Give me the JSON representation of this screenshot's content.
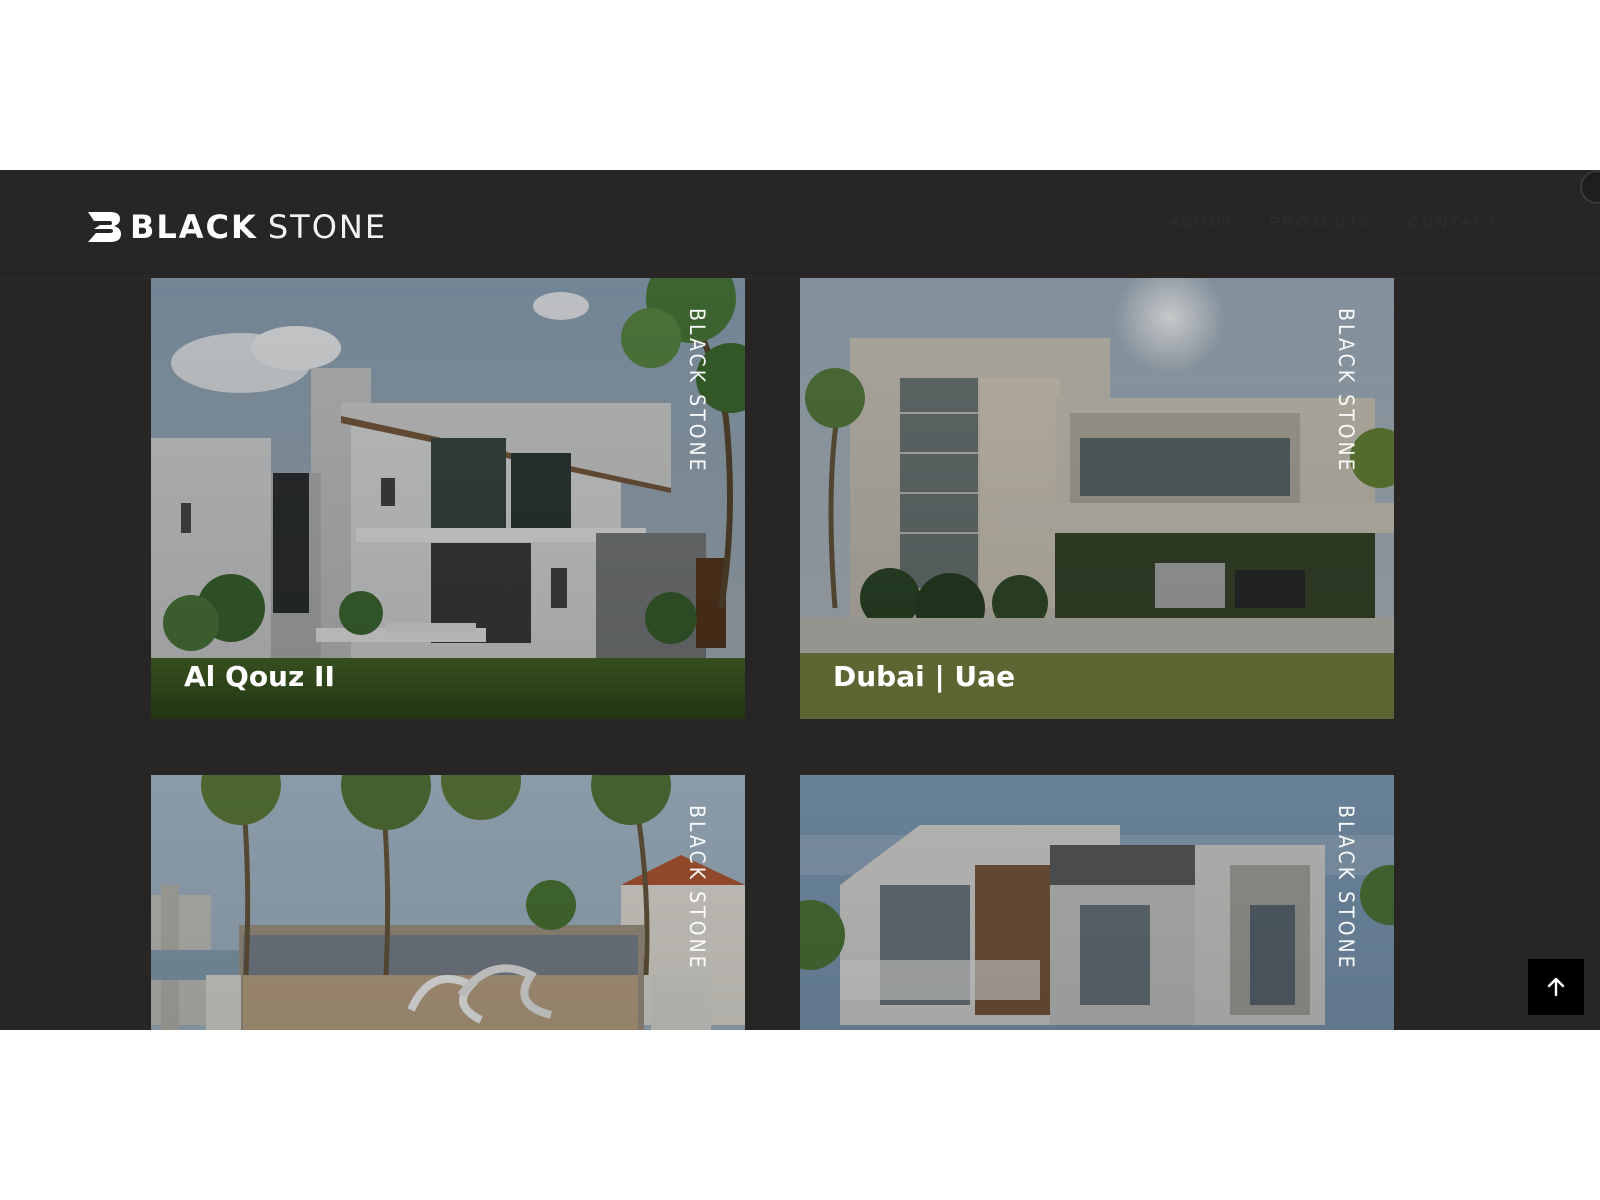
{
  "brand": {
    "name_bold": "BLACK",
    "name_light": "STONE"
  },
  "nav": {
    "items": [
      {
        "label": "ABOUT"
      },
      {
        "label": "PROJECTS"
      },
      {
        "label": "CONTACT"
      }
    ]
  },
  "projects": [
    {
      "title": "Al Qouz II",
      "watermark": "BLACK STONE"
    },
    {
      "title": "Dubai | Uae",
      "watermark": "BLACK STONE"
    },
    {
      "title": "",
      "watermark": "BLACK STONE"
    },
    {
      "title": "",
      "watermark": "BLACK STONE"
    }
  ],
  "controls": {
    "back_to_top_icon": "arrow-up-icon"
  },
  "colors": {
    "page_background": "#272624",
    "text": "#ffffff",
    "button": "#000000"
  }
}
